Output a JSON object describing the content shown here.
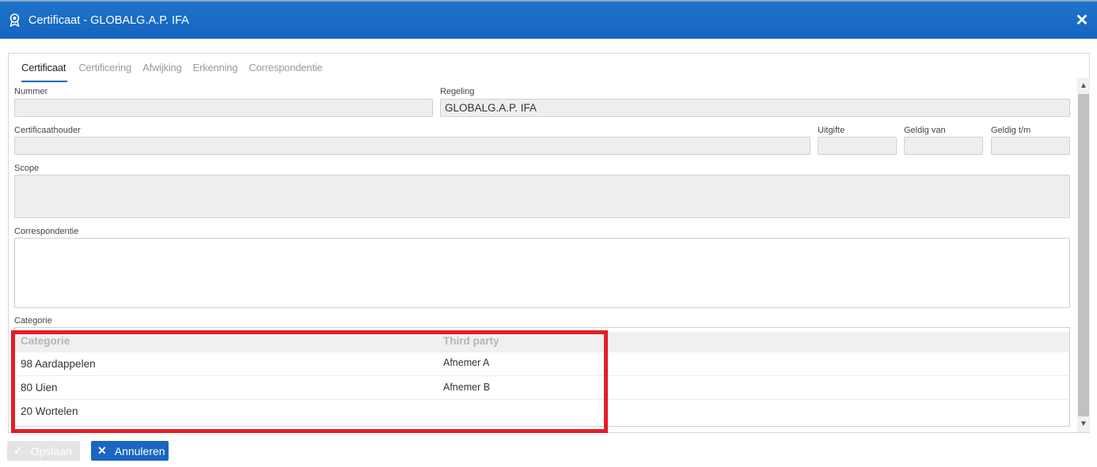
{
  "window": {
    "title": "Certificaat - GLOBALG.A.P. IFA",
    "icon": "certificate-icon",
    "close_icon": "close-icon"
  },
  "tabs": [
    {
      "label": "Certificaat",
      "active": true
    },
    {
      "label": "Certificering",
      "active": false
    },
    {
      "label": "Afwijking",
      "active": false
    },
    {
      "label": "Erkenning",
      "active": false
    },
    {
      "label": "Correspondentie",
      "active": false
    }
  ],
  "form": {
    "nummer": {
      "label": "Nummer",
      "value": ""
    },
    "regeling": {
      "label": "Regeling",
      "value": "GLOBALG.A.P. IFA"
    },
    "certificaathouder": {
      "label": "Certificaathouder",
      "value": ""
    },
    "uitgifte": {
      "label": "Uitgifte",
      "value": ""
    },
    "geldig_van": {
      "label": "Geldig van",
      "value": ""
    },
    "geldig_tm": {
      "label": "Geldig t/m",
      "value": ""
    },
    "scope": {
      "label": "Scope",
      "value": ""
    },
    "correspondentie": {
      "label": "Correspondentie",
      "value": ""
    },
    "categorie_label": "Categorie"
  },
  "grid": {
    "headers": [
      "Categorie",
      "Third party"
    ],
    "rows": [
      {
        "categorie": "98 Aardappelen",
        "third_party": "Afnemer A"
      },
      {
        "categorie": "80 Uien",
        "third_party": "Afnemer B"
      },
      {
        "categorie": "20 Wortelen",
        "third_party": ""
      }
    ]
  },
  "buttons": {
    "save": {
      "label": "Opslaan",
      "icon": "check-icon",
      "enabled": false
    },
    "cancel": {
      "label": "Annuleren",
      "icon": "close-icon",
      "enabled": true
    }
  },
  "colors": {
    "titlebar": "#1565c0",
    "highlight": "#e31e24",
    "primary_button": "#1a66c2"
  }
}
